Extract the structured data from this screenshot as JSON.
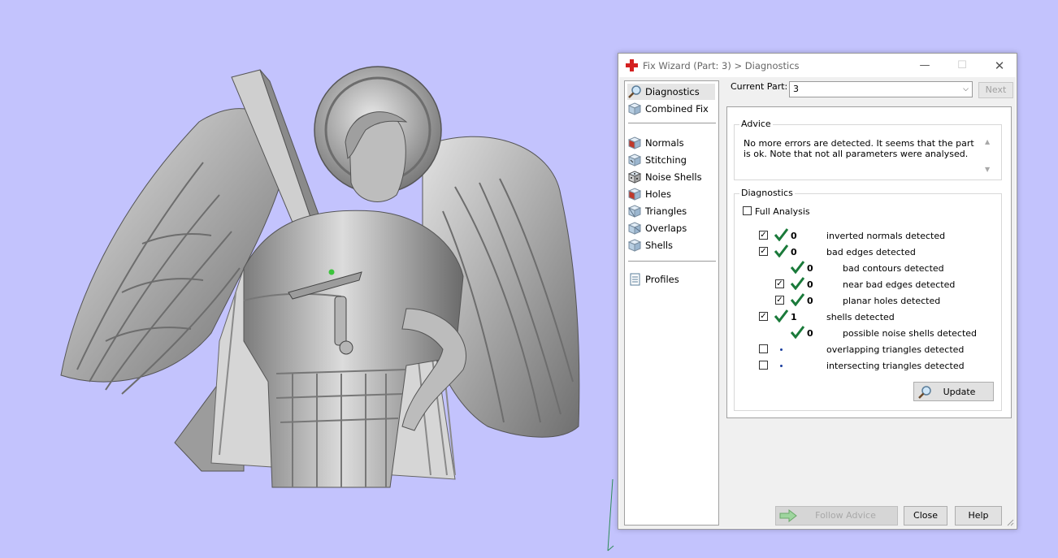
{
  "colors": {
    "viewport_bg": "#c3c3fd",
    "check_green": "#1a7a3a",
    "dot_blue": "#1b3f9f"
  },
  "viewport": {
    "model_icon": "angel-statue-3d-model"
  },
  "dialog": {
    "title": "Fix Wizard (Part: 3) > Diagnostics",
    "window_buttons": {
      "minimize": "—",
      "maximize": "☐",
      "close": "✕"
    },
    "nav": {
      "items": [
        {
          "label": "Diagnostics",
          "icon": "magnifier-icon",
          "selected": true
        },
        {
          "label": "Combined Fix",
          "icon": "cube-icon"
        },
        {
          "label": "Normals",
          "icon": "normals-cube-icon"
        },
        {
          "label": "Stitching",
          "icon": "stitching-cube-icon"
        },
        {
          "label": "Noise Shells",
          "icon": "noise-shells-icon"
        },
        {
          "label": "Holes",
          "icon": "holes-cube-icon"
        },
        {
          "label": "Triangles",
          "icon": "triangles-cube-icon"
        },
        {
          "label": "Overlaps",
          "icon": "overlaps-cube-icon"
        },
        {
          "label": "Shells",
          "icon": "shells-cube-icon"
        },
        {
          "label": "Profiles",
          "icon": "document-icon"
        }
      ]
    },
    "current_part": {
      "label": "Current Part:",
      "value": "3"
    },
    "next_label": "Next",
    "advice": {
      "title": "Advice",
      "text": "No more errors are detected. It seems that the part is ok. Note that not all parameters were analysed."
    },
    "diagnostics": {
      "title": "Diagnostics",
      "full_analysis": {
        "label": "Full Analysis",
        "checked": false
      },
      "rows": [
        {
          "checked": true,
          "ok": true,
          "count": "0",
          "label": "inverted normals detected"
        },
        {
          "checked": true,
          "ok": true,
          "count": "0",
          "label": "bad edges detected"
        },
        {
          "ok": true,
          "count": "0",
          "label": "bad contours detected"
        },
        {
          "checked": true,
          "ok": true,
          "count": "0",
          "label": "near bad edges detected"
        },
        {
          "checked": true,
          "ok": true,
          "count": "0",
          "label": "planar holes detected"
        },
        {
          "checked": true,
          "ok": true,
          "count": "1",
          "label": "shells detected"
        },
        {
          "ok": true,
          "count": "0",
          "label": "possible noise shells detected"
        },
        {
          "checked": false,
          "label": "overlapping triangles detected"
        },
        {
          "checked": false,
          "label": "intersecting triangles detected"
        }
      ],
      "update_label": "Update"
    },
    "buttons": {
      "follow_advice": "Follow Advice",
      "close": "Close",
      "help": "Help"
    }
  }
}
